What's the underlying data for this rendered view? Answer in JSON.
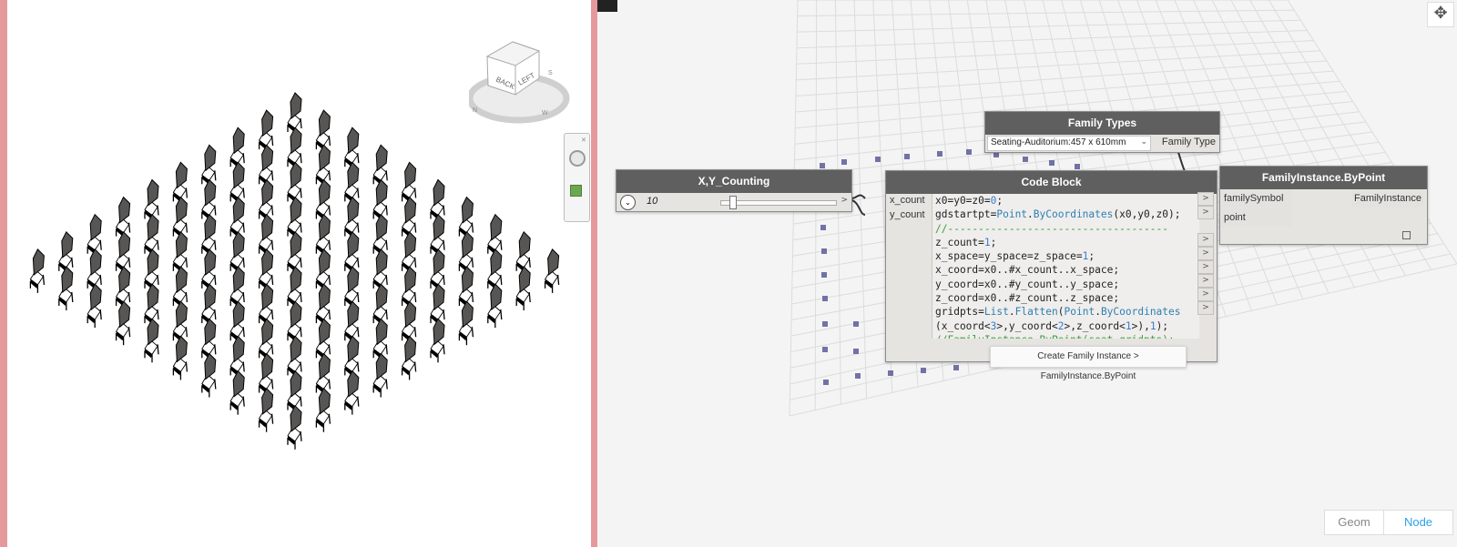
{
  "viewcube": {
    "back": "BACK",
    "left": "LEFT"
  },
  "slider_node": {
    "title": "X,Y_Counting",
    "value": "10"
  },
  "family_types_node": {
    "title": "Family Types",
    "selected": "Seating-Auditorium:457 x 610mm",
    "output": "Family Type"
  },
  "code_block_node": {
    "title": "Code Block",
    "inputs": [
      "x_count",
      "y_count"
    ],
    "tooltip": "Create Family Instance > FamilyInstance.ByPoint"
  },
  "fi_node": {
    "title": "FamilyInstance.ByPoint",
    "inputs": [
      "familySymbol",
      "point"
    ],
    "output": "FamilyInstance"
  },
  "view_toggle": {
    "geom": "Geom",
    "node": "Node"
  },
  "colors": {
    "node_header": "#5f5f5f",
    "node_body": "#e6e4e0",
    "accent": "#2aa3e6",
    "border": "#e6999c"
  }
}
